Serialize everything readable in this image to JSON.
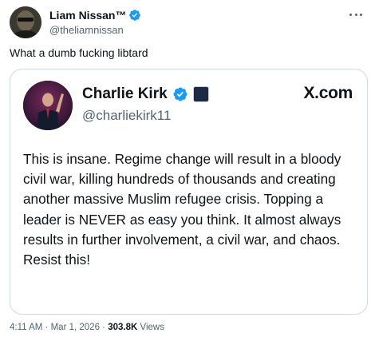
{
  "author": {
    "display_name": "Liam Nissan™",
    "handle": "@theliamnissan",
    "avatar_icon": "user-avatar",
    "verified_icon": "verified-badge-icon"
  },
  "tweet": {
    "text": "What a dumb fucking libtard"
  },
  "quoted": {
    "display_name": "Charlie Kirk",
    "handle": "@charliekirk11",
    "site": "X.com",
    "badge_icon": "affiliate-badge-icon",
    "badge_text": "",
    "body": "This is insane. Regime change will result in a bloody civil war, killing hundreds of thousands and creating another massive Muslim refugee crisis. Topping a leader is NEVER as easy you think. It almost always results in further involvement, a civil war, and chaos. Resist this!"
  },
  "meta": {
    "time": "4:11 AM",
    "separator": "·",
    "date": "Mar 1, 2026",
    "views_count": "303.8K",
    "views_label": "Views"
  },
  "colors": {
    "verified_blue": "#1d9bf0",
    "text_primary": "#0f1419",
    "text_secondary": "#536471",
    "border": "#cfd9de"
  }
}
